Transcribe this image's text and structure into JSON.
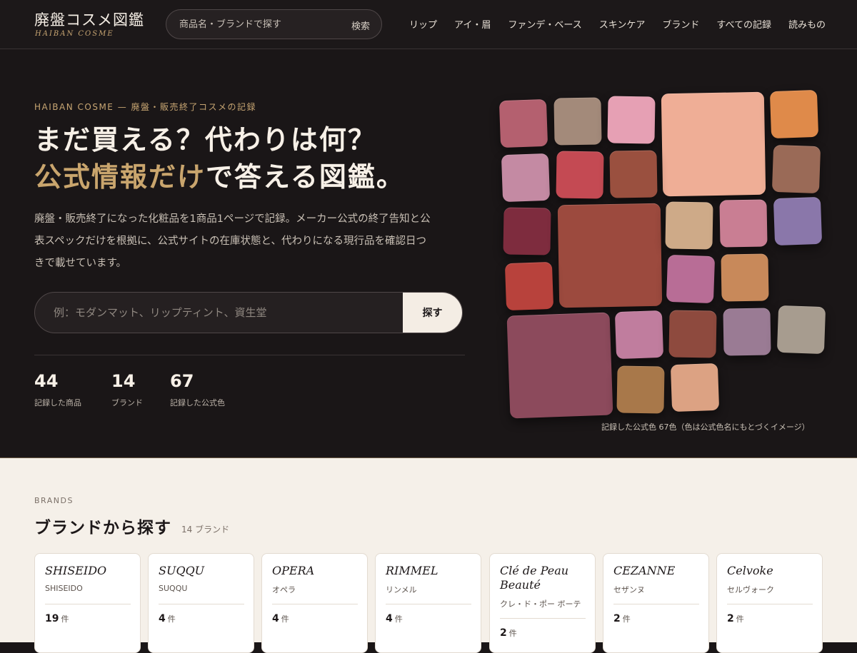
{
  "header": {
    "logo_ja": "廃盤コスメ図鑑",
    "logo_en": "HAIBAN COSME",
    "search_placeholder": "商品名・ブランドで探す",
    "search_button": "検索",
    "nav": [
      "リップ",
      "アイ・眉",
      "ファンデ・ベース",
      "スキンケア",
      "ブランド",
      "すべての記録",
      "読みもの"
    ]
  },
  "hero": {
    "eyebrow": "HAIBAN COSME — 廃盤・販売終了コスメの記録",
    "title_line1": "まだ買える？代わりは何？",
    "title_line2_gold": "公式情報だけ",
    "title_line2_rest": "で答える図鑑。",
    "lead": "廃盤・販売終了になった化粧品を1商品1ページで記録。メーカー公式の終了告知と公表スペックだけを根拠に、公式サイトの在庫状態と、代わりになる現行品を確認日つきで載せています。",
    "search_placeholder": "例：モダンマット、リップティント、資生堂",
    "search_button": "探す",
    "stats": [
      {
        "num": "44",
        "label": "記録した商品"
      },
      {
        "num": "14",
        "label": "ブランド"
      },
      {
        "num": "67",
        "label": "記録した公式色"
      }
    ],
    "swatch_caption": "記録した公式色 67色（色は公式色名にもとづくイメージ）"
  },
  "brands": {
    "eyebrow": "BRANDS",
    "title": "ブランドから探す",
    "count": "14 ブランド",
    "count_unit": "件",
    "items": [
      {
        "name_en": "SHISEIDO",
        "name_ja": "SHISEIDO",
        "count": "19"
      },
      {
        "name_en": "SUQQU",
        "name_ja": "SUQQU",
        "count": "4"
      },
      {
        "name_en": "OPERA",
        "name_ja": "オペラ",
        "count": "4"
      },
      {
        "name_en": "RIMMEL",
        "name_ja": "リンメル",
        "count": "4"
      },
      {
        "name_en": "Clé de Peau Beauté",
        "name_ja": "クレ・ド・ポー ボーテ",
        "count": "2"
      },
      {
        "name_en": "CEZANNE",
        "name_ja": "セザンヌ",
        "count": "2"
      },
      {
        "name_en": "Celvoke",
        "name_ja": "セルヴォーク",
        "count": "2"
      }
    ]
  },
  "colors": {
    "accent_gold": "#c9a56d",
    "dark_bg": "#1a1617",
    "cream_bg": "#f5f0e9",
    "swatches": [
      "#b4606f",
      "#a38a7a",
      "#e6a0b4",
      "#efae96",
      "#df8a4a",
      "#c48aa3",
      "#c44a53",
      "#9a503f",
      "#9a6a57",
      "#7e2c3e",
      "#9c4a3e",
      "#ceaa88",
      "#c97e93",
      "#8a77aa",
      "#b8423c",
      "#b86d96",
      "#c8895a",
      "#8c4a5c",
      "#c07d9e",
      "#8e4a3e",
      "#9a7b94",
      "#a79c8f",
      "#a8784a",
      "#dca283"
    ]
  }
}
